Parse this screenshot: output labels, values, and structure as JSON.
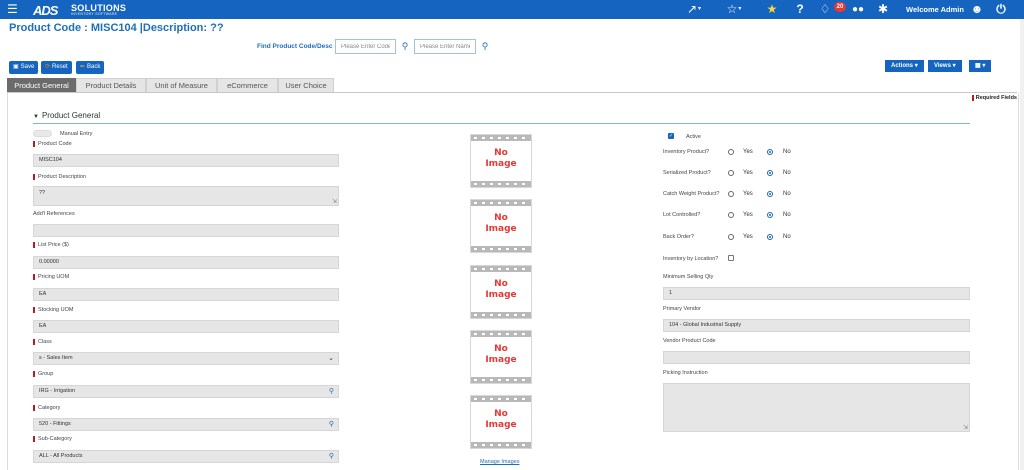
{
  "brand": {
    "logo_mark": "ADS",
    "logo_word": "SOLUTIONS",
    "logo_sub": "INVENTORY SOFTWARE",
    "primary_color": "#1565c0",
    "accent_color": "#1e6fb8",
    "required_color": "#b71c1c"
  },
  "topbar": {
    "notification_count": "20",
    "welcome_text": "Welcome Admin",
    "icons": [
      "menu-icon",
      "share-icon",
      "star-outline-icon",
      "star-filled-icon",
      "help-icon",
      "bell-icon",
      "users-icon",
      "gear-icon",
      "user-circle-icon",
      "power-icon"
    ]
  },
  "header": {
    "title": "Product Code  : MISC104 |Description: ??",
    "find_label": "Find Product Code/Desc",
    "code_placeholder": "Please Enter Code",
    "name_placeholder": "Please Enter Name"
  },
  "toolbar": {
    "save": "Save",
    "reset": "Reset",
    "back": "Back",
    "actions": "Actions",
    "views": "Views"
  },
  "tabs": [
    {
      "label": "Product General",
      "active": true
    },
    {
      "label": "Product Details",
      "active": false
    },
    {
      "label": "Unit of Measure",
      "active": false
    },
    {
      "label": "eCommerce",
      "active": false
    },
    {
      "label": "User Choice",
      "active": false
    }
  ],
  "required_fields_label": "Required Fields",
  "section": {
    "title": "Product General"
  },
  "left": {
    "manual_entry": "Manual Entry",
    "product_code_label": "Product Code",
    "product_code": "MISC104",
    "description_label": "Product Description",
    "description": "??",
    "addl_refs_label": "Add'l References",
    "addl_refs": "",
    "list_price_label": "List Price ($)",
    "list_price": "0.00000",
    "pricing_uom_label": "Pricing UOM",
    "pricing_uom": "EA",
    "stocking_uom_label": "Stocking UOM",
    "stocking_uom": "EA",
    "class_label": "Class",
    "class": "s - Sales Item",
    "group_label": "Group",
    "group": "IRG - Irrigation",
    "category_label": "Category",
    "category": "520 - Fittings",
    "subcategory_label": "Sub-Category",
    "subcategory": "ALL - All Products"
  },
  "images": {
    "placeholder_line1": "No",
    "placeholder_line2": "Image",
    "manage_link": "Manage Images"
  },
  "right": {
    "active_label": "Active",
    "active": true,
    "yes": "Yes",
    "no": "No",
    "inventory_product_label": "Inventory Product?",
    "serialized_label": "Serialized Product?",
    "catch_weight_label": "Catch Weight Product?",
    "lot_controlled_label": "Lot Controlled?",
    "back_order_label": "Back Order?",
    "inventory_by_location_label": "Inventory by Location?",
    "inventory_by_location": false,
    "min_qty_label": "Minimum Selling Qty",
    "min_qty": "1",
    "primary_vendor_label": "Primary Vendor",
    "primary_vendor": "104 - Global Industrial Supply",
    "vendor_code_label": "Vendor Product Code",
    "vendor_code": "",
    "picking_label": "Picking Instruction",
    "picking": ""
  }
}
